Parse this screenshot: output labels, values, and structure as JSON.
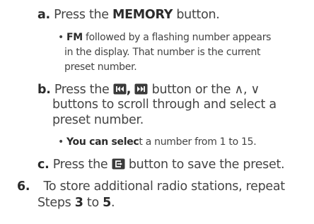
{
  "steps": {
    "a": {
      "marker": "a.",
      "prefix": "Press the ",
      "keyword": "MEMORY",
      "suffix": " button.",
      "bullet": {
        "lead": "FM",
        "line1": " followed by a flashing number appears",
        "line2": "in the display. That number is the current",
        "line3": "preset number."
      }
    },
    "b": {
      "marker": "b.",
      "line1_prefix": "Press the ",
      "comma1": ",",
      "line1_mid": " button or the ",
      "up_glyph": "∧",
      "comma2": ",",
      "down_glyph": "∨",
      "line2": "buttons to scroll through and select a",
      "line3": "preset number.",
      "bullet": {
        "bold_part": "You can selec",
        "rest": "t a number from 1 to 15."
      }
    },
    "c": {
      "marker": "c.",
      "prefix": "Press the ",
      "suffix": " button to save the preset."
    },
    "step6": {
      "marker": "6.",
      "line1": "To store additional radio stations, repeat",
      "line2_prefix": "Steps ",
      "from_step": "3",
      "to_word": " to ",
      "to_step": "5",
      "period": "."
    },
    "icons": {
      "prev": "skip-previous-icon",
      "next": "skip-next-icon",
      "enter": "enter-icon"
    }
  }
}
